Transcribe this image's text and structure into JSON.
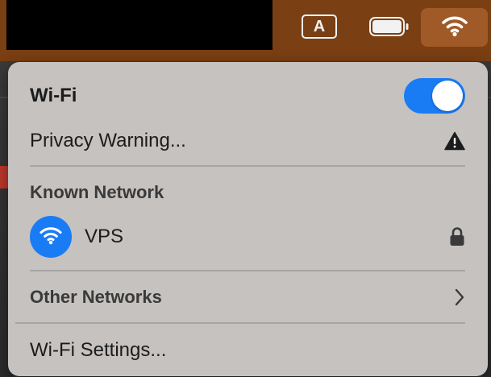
{
  "menubar": {
    "input_source_label": "A",
    "icons": {
      "input_source": "input-source-icon",
      "battery": "battery-icon",
      "wifi": "wifi-icon"
    }
  },
  "wifi_menu": {
    "title": "Wi-Fi",
    "toggle_on": true,
    "privacy_warning_label": "Privacy Warning...",
    "known_network_header": "Known Network",
    "known_networks": [
      {
        "name": "VPS",
        "secured": true,
        "connected": true
      }
    ],
    "other_networks_label": "Other Networks",
    "settings_label": "Wi-Fi Settings..."
  },
  "colors": {
    "menubar": "#7a3f13",
    "panel": "#c5c2c0",
    "accent": "#1a7cf5"
  }
}
